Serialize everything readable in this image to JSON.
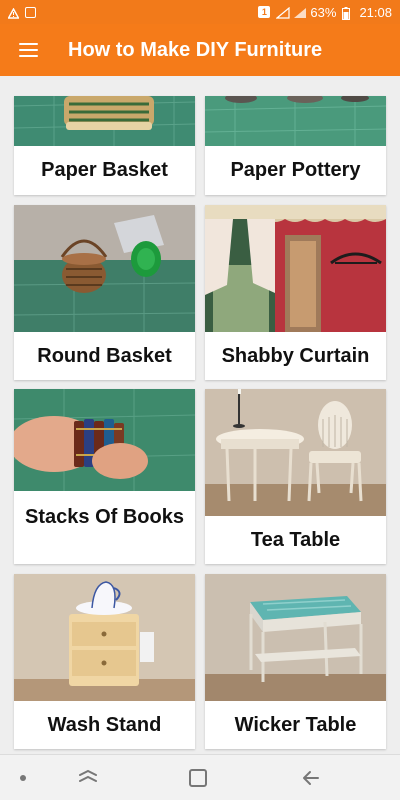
{
  "status_bar": {
    "battery": "63%",
    "time": "21:08",
    "sim_badge": "1"
  },
  "app_bar": {
    "title": "How to Make DIY Furniture",
    "menu_icon": "hamburger-menu-icon"
  },
  "items": [
    {
      "label": "Paper Basket"
    },
    {
      "label": "Paper Pottery"
    },
    {
      "label": "Round Basket"
    },
    {
      "label": "Shabby Curtain"
    },
    {
      "label": "Stacks Of Books"
    },
    {
      "label": "Tea Table"
    },
    {
      "label": "Wash Stand"
    },
    {
      "label": "Wicker Table"
    }
  ],
  "nav_bar": {
    "icons": [
      "dot-icon",
      "recent-apps-icon",
      "home-icon",
      "back-icon"
    ]
  },
  "colors": {
    "accent": "#f57b19",
    "card": "#ffffff",
    "background": "#eeeeee"
  }
}
